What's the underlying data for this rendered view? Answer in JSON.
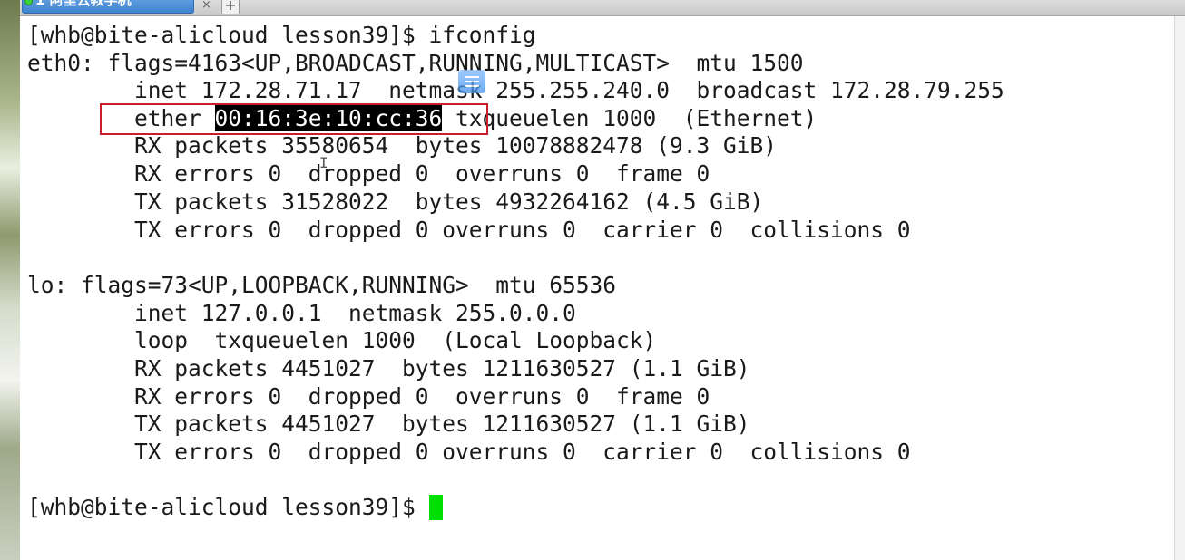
{
  "window": {
    "tab_label": "1 阿里云教学机",
    "tab_close": "×",
    "new_tab": "+"
  },
  "terminal": {
    "lines": [
      "[whb@bite-alicloud lesson39]$ ifconfig",
      "eth0: flags=4163<UP,BROADCAST,RUNNING,MULTICAST>  mtu 1500",
      "        inet 172.28.71.17  netmask 255.255.240.0  broadcast 172.28.79.255",
      "        ether ",
      "        RX packets 35580654  bytes 10078882478 (9.3 GiB)",
      "        RX errors 0  dropped 0  overruns 0  frame 0",
      "        TX packets 31528022  bytes 4932264162 (4.5 GiB)",
      "        TX errors 0  dropped 0 overruns 0  carrier 0  collisions 0",
      "",
      "lo: flags=73<UP,LOOPBACK,RUNNING>  mtu 65536",
      "        inet 127.0.0.1  netmask 255.0.0.0",
      "        loop  txqueuelen 1000  (Local Loopback)",
      "        RX packets 4451027  bytes 1211630527 (1.1 GiB)",
      "        RX errors 0  dropped 0  overruns 0  frame 0",
      "        TX packets 4451027  bytes 1211630527 (1.1 GiB)",
      "        TX errors 0  dropped 0 overruns 0  carrier 0  collisions 0",
      "",
      "[whb@bite-alicloud lesson39]$ "
    ],
    "ether_mac": "00:16:3e:10:cc:36",
    "ether_suffix": " txqueuelen 1000  (Ethernet)"
  },
  "colors": {
    "cursor": "#00e000",
    "highlight_box": "#c8202a",
    "tab": "#3f83d1"
  }
}
